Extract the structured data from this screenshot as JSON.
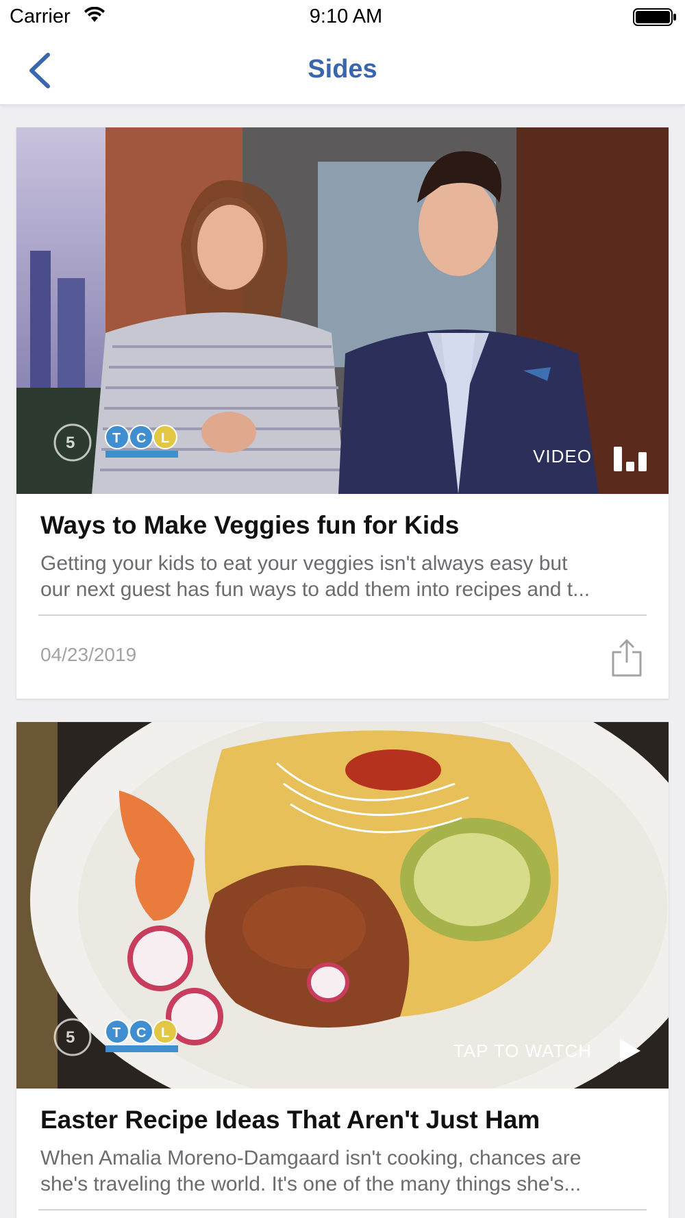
{
  "status_bar": {
    "carrier": "Carrier",
    "time": "9:10 AM"
  },
  "nav": {
    "title": "Sides",
    "back_icon": "chevron-left-icon",
    "accent_color": "#3a66ad"
  },
  "articles": [
    {
      "title": "Ways to Make Veggies fun for Kids",
      "description_line1": "Getting your kids to eat your veggies isn't always easy but",
      "description_line2": "our next guest has fun ways to add them into recipes and t...",
      "date": "04/23/2019",
      "media_label": "VIDEO",
      "media_icon": "video-bars-icon",
      "share_icon": "share-icon"
    },
    {
      "title": "Easter Recipe Ideas That Aren't Just Ham",
      "description_line1": "When Amalia Moreno-Damgaard isn't cooking, chances are",
      "description_line2": "she's traveling the world. It's one of the many things she's...",
      "media_label": "TAP TO WATCH",
      "media_icon": "play-icon"
    }
  ]
}
